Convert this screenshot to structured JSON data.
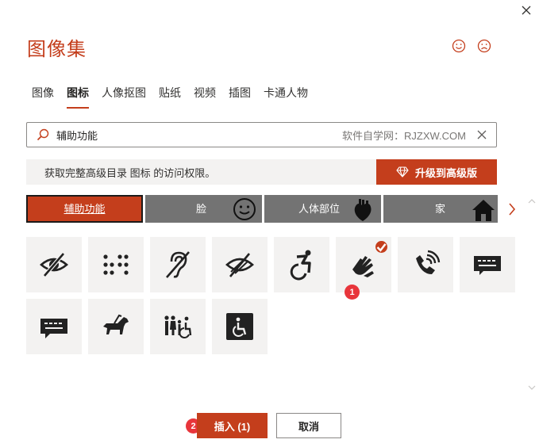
{
  "dialog": {
    "title": "图像集",
    "close_icon": "close-icon",
    "feedback": {
      "smile_icon": "smile-face-icon",
      "frown_icon": "frown-face-icon"
    }
  },
  "tabs": [
    {
      "label": "图像",
      "active": false
    },
    {
      "label": "图标",
      "active": true
    },
    {
      "label": "人像抠图",
      "active": false
    },
    {
      "label": "贴纸",
      "active": false
    },
    {
      "label": "视频",
      "active": false
    },
    {
      "label": "插图",
      "active": false
    },
    {
      "label": "卡通人物",
      "active": false
    }
  ],
  "search": {
    "value": "辅助功能",
    "hint": "软件自学网：RJZXW.COM",
    "icon": "search-icon",
    "clear_icon": "clear-icon"
  },
  "banner": {
    "text": "获取完整高级目录 图标 的访问权限。",
    "upgrade_label": "升级到高级版",
    "upgrade_icon": "diamond-icon"
  },
  "categories": [
    {
      "label": "辅助功能",
      "active": true
    },
    {
      "label": "脸",
      "active": false,
      "icon": "face-icon"
    },
    {
      "label": "人体部位",
      "active": false,
      "icon": "heart-organ-icon"
    },
    {
      "label": "家",
      "active": false,
      "icon": "house-icon"
    }
  ],
  "icons": [
    {
      "name": "eye-slash-icon",
      "selected": false
    },
    {
      "name": "braille-icon",
      "selected": false
    },
    {
      "name": "hearing-impaired-icon",
      "selected": false
    },
    {
      "name": "low-vision-icon",
      "selected": false
    },
    {
      "name": "active-wheelchair-icon",
      "selected": false
    },
    {
      "name": "sign-language-icon",
      "selected": true
    },
    {
      "name": "volume-phone-icon",
      "selected": false
    },
    {
      "name": "tty-keyboard-icon",
      "selected": false
    },
    {
      "name": "captions-bubble-icon",
      "selected": false
    },
    {
      "name": "guide-dog-icon",
      "selected": false
    },
    {
      "name": "family-restroom-icon",
      "selected": false
    },
    {
      "name": "accessible-sign-icon",
      "selected": false
    }
  ],
  "markers": {
    "first": "1",
    "second": "2"
  },
  "footer": {
    "insert_label": "插入 (1)",
    "cancel_label": "取消"
  },
  "colors": {
    "accent": "#c43e1c",
    "chip_gray": "#737373",
    "tile_bg": "#f3f2f1",
    "marker": "#e8353b"
  }
}
